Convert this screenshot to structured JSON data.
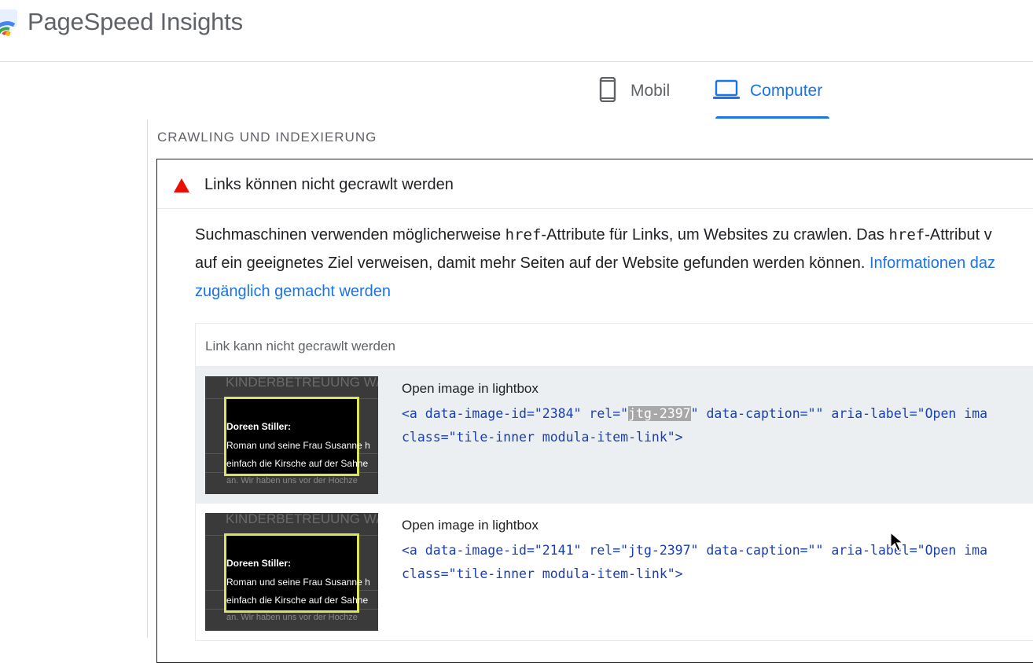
{
  "app": {
    "title": "PageSpeed Insights"
  },
  "tabs": [
    {
      "label": "Mobil",
      "icon": "smartphone-icon",
      "selected": false
    },
    {
      "label": "Computer",
      "icon": "laptop-icon",
      "selected": true
    }
  ],
  "colors": {
    "accent": "#1a73e8",
    "fail": "#eb0f00",
    "code": "#1a3fb0",
    "thumb_border": "#d9e35b"
  },
  "section": {
    "title": "CRAWLING UND INDEXIERUNG"
  },
  "audit": {
    "status_icon": "fail-triangle-icon",
    "title": "Links können nicht gecrawlt werden",
    "desc_part1": "Suchmaschinen verwenden möglicherweise ",
    "desc_code1": "href",
    "desc_part2": "-Attribute für Links, um Websites zu crawlen. Das ",
    "desc_code2": "href",
    "desc_part3": "-Attribut v",
    "desc_part4": "auf ein geeignetes Ziel verweisen, damit mehr Seiten auf der Website gefunden werden können. ",
    "desc_link_line1": "Informationen daz",
    "desc_link_line2": "zugänglich gemacht werden"
  },
  "table": {
    "column_header": "Link kann nicht gecrawlt werden",
    "rows": [
      {
        "label": "Open image in lightbox",
        "code_pre": "<a data-image-id=\"2384\" rel=\"",
        "code_highlight": "jtg-2397",
        "code_post": "\" data-caption=\"\" aria-label=\"Open ima",
        "code_line2": "class=\"tile-inner modula-item-link\">",
        "thumb": {
          "top_text": "KINDERBETREUUNG W/",
          "name": "Doreen Stiller:",
          "line1": "Roman und seine Frau Susanne h",
          "line2": "einfach die Kirsche auf der Sahne",
          "line3": "an. Wir haben uns vor der Hochze"
        }
      },
      {
        "label": "Open image in lightbox",
        "code_pre": "<a data-image-id=\"2141\" rel=\"jtg-2397\" data-caption=\"\" aria-label=\"Open ima",
        "code_highlight": "",
        "code_post": "",
        "code_line2": "class=\"tile-inner modula-item-link\">",
        "thumb": {
          "top_text": "KINDERBETREUUNG W/",
          "name": "Doreen Stiller:",
          "line1": "Roman und seine Frau Susanne h",
          "line2": "einfach die Kirsche auf der Sahne",
          "line3": "an. Wir haben uns vor der Hochze"
        }
      }
    ]
  }
}
